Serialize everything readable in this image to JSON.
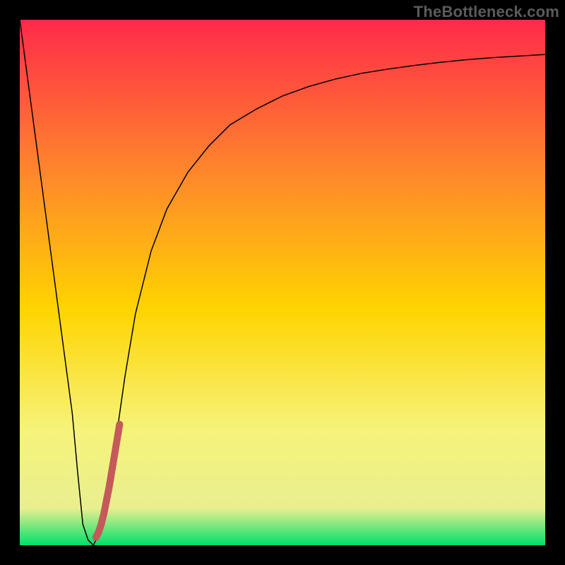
{
  "watermark": "TheBottleneck.com",
  "chart_data": {
    "type": "line",
    "title": "",
    "xlabel": "",
    "ylabel": "",
    "xlim": [
      0,
      100
    ],
    "ylim": [
      0,
      100
    ],
    "grid": false,
    "legend": false,
    "background_gradient": {
      "top": "#ff2a4a",
      "mid_upper": "#ff8a2a",
      "mid": "#ffd400",
      "mid_lower": "#f6f37a",
      "bottom_band": "#e9ef8f",
      "bottom": "#00e06a"
    },
    "series": [
      {
        "name": "bottleneck-curve",
        "color": "#000000",
        "stroke_width": 1.5,
        "x": [
          0,
          2,
          4,
          6,
          8,
          10,
          11,
          12,
          13,
          14,
          15,
          16,
          18,
          20,
          22,
          25,
          28,
          32,
          36,
          40,
          45,
          50,
          55,
          60,
          65,
          70,
          75,
          80,
          85,
          90,
          95,
          100
        ],
        "y": [
          100,
          85,
          70,
          55,
          40,
          25,
          14,
          4,
          1,
          0,
          2,
          6,
          18,
          32,
          44,
          56,
          64,
          71,
          76,
          80,
          83,
          85.5,
          87.3,
          88.7,
          89.8,
          90.6,
          91.3,
          91.9,
          92.4,
          92.8,
          93.1,
          93.4
        ]
      },
      {
        "name": "highlight-segment",
        "color": "#c45a5a",
        "stroke_width": 10,
        "linecap": "round",
        "x": [
          14.5,
          15.0,
          15.5,
          16.0,
          16.5,
          17.0,
          17.5,
          18.0,
          18.5,
          19.0
        ],
        "y": [
          1.5,
          2.5,
          4.0,
          6.0,
          8.5,
          11.0,
          14.0,
          17.0,
          20.0,
          23.0
        ]
      }
    ],
    "annotations": []
  }
}
